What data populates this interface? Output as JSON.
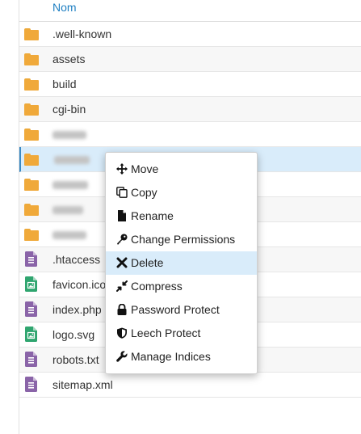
{
  "table": {
    "column_name": "Nom",
    "rows": [
      {
        "name": ".well-known",
        "type": "folder",
        "blurred": false
      },
      {
        "name": "assets",
        "type": "folder",
        "blurred": false
      },
      {
        "name": "build",
        "type": "folder",
        "blurred": false
      },
      {
        "name": "cgi-bin",
        "type": "folder",
        "blurred": false
      },
      {
        "name": "",
        "type": "folder",
        "blurred": true
      },
      {
        "name": "",
        "type": "folder",
        "blurred": true,
        "selected": true
      },
      {
        "name": "",
        "type": "folder",
        "blurred": true
      },
      {
        "name": "",
        "type": "folder",
        "blurred": true
      },
      {
        "name": "",
        "type": "folder",
        "blurred": true
      },
      {
        "name": ".htaccess",
        "type": "text-file",
        "blurred": false
      },
      {
        "name": "favicon.ico",
        "type": "image-file",
        "blurred": false
      },
      {
        "name": "index.php",
        "type": "text-file",
        "blurred": false
      },
      {
        "name": "logo.svg",
        "type": "image-file",
        "blurred": false
      },
      {
        "name": "robots.txt",
        "type": "text-file",
        "blurred": false
      },
      {
        "name": "sitemap.xml",
        "type": "text-file",
        "blurred": false
      }
    ]
  },
  "context_menu": {
    "items": [
      {
        "label": "Move",
        "icon": "move-icon"
      },
      {
        "label": "Copy",
        "icon": "copy-icon"
      },
      {
        "label": "Rename",
        "icon": "file-icon"
      },
      {
        "label": "Change Permissions",
        "icon": "key-icon"
      },
      {
        "label": "Delete",
        "icon": "close-icon",
        "hovered": true
      },
      {
        "label": "Compress",
        "icon": "compress-icon"
      },
      {
        "label": "Password Protect",
        "icon": "lock-icon"
      },
      {
        "label": "Leech Protect",
        "icon": "shield-icon"
      },
      {
        "label": "Manage Indices",
        "icon": "wrench-icon"
      }
    ]
  },
  "colors": {
    "folder": "#f0a93a",
    "text_file": "#8a64a8",
    "image_file": "#2fa56f",
    "header_link": "#1e7fc2",
    "selected_row": "#d9ecfa"
  }
}
